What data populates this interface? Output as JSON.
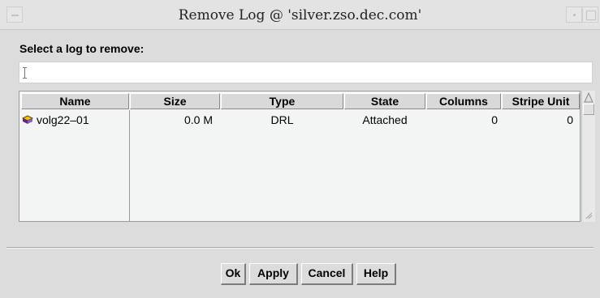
{
  "window": {
    "title": "Remove Log @ 'silver.zso.dec.com'"
  },
  "prompt": {
    "label": "Select a log to remove:"
  },
  "input": {
    "value": ""
  },
  "table": {
    "headers": [
      "Name",
      "Size",
      "Type",
      "State",
      "Columns",
      "Stripe Unit"
    ],
    "rows": [
      {
        "icon": "volume-log-icon",
        "name": "volg22–01",
        "size": "0.0 M",
        "type": "DRL",
        "state": "Attached",
        "columns": "0",
        "stripe_unit": "0"
      }
    ]
  },
  "buttons": {
    "ok": "Ok",
    "apply": "Apply",
    "cancel": "Cancel",
    "help": "Help"
  },
  "colors": {
    "window_bg": "#dcdcdc",
    "table_bg": "#f2f5f4",
    "icon_yellow": "#f2c400",
    "icon_purple": "#5a2a8a"
  }
}
